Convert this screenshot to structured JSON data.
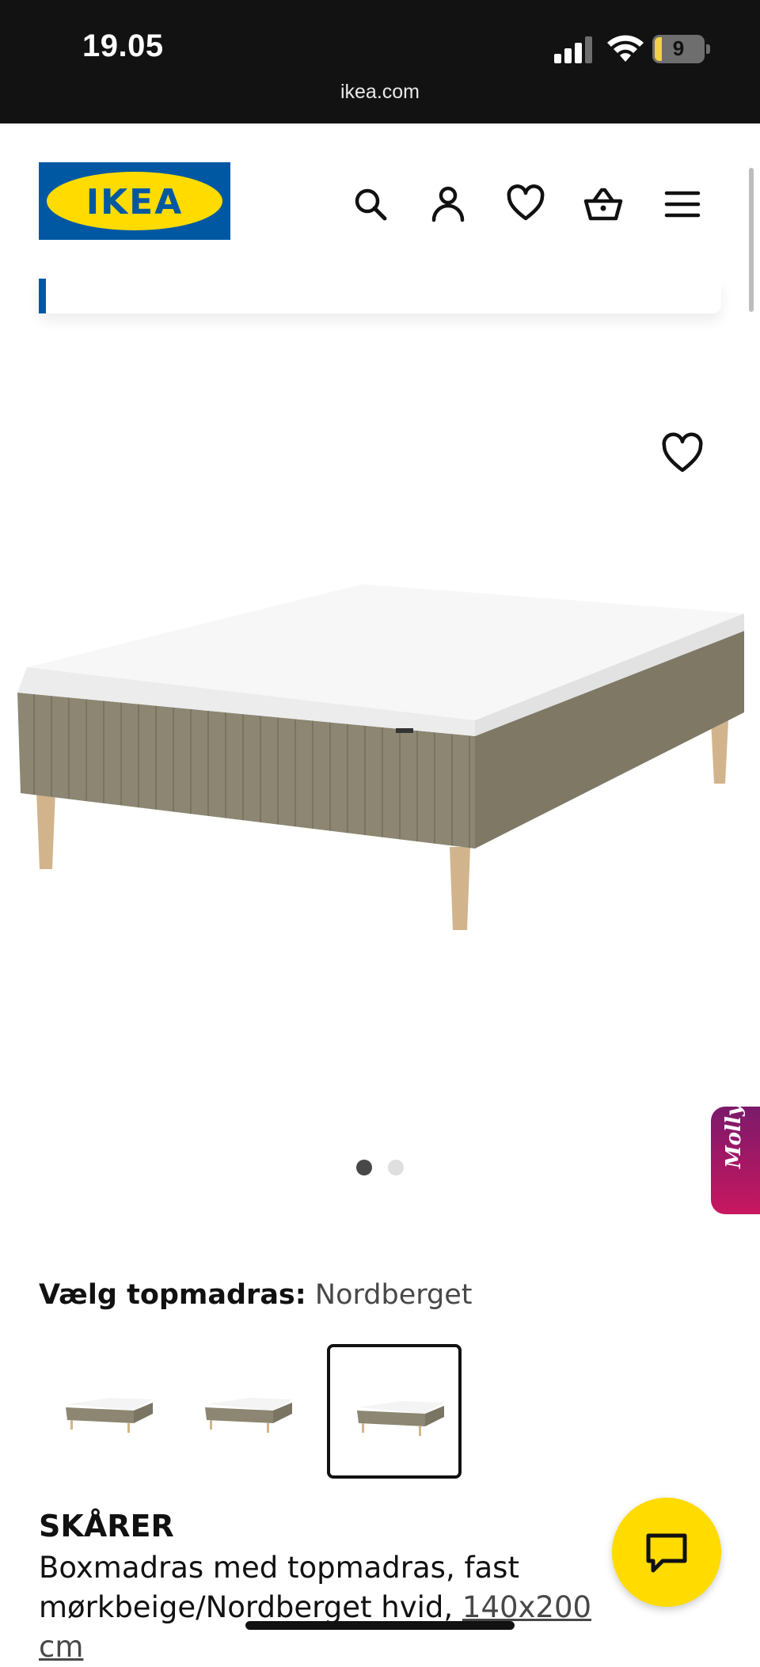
{
  "status_bar": {
    "time": "19.05",
    "battery_level": "9",
    "url": "ikea.com"
  },
  "header": {
    "logo_text": "IKEA",
    "icons": [
      "search-icon",
      "account-icon",
      "heart-icon",
      "basket-icon",
      "menu-icon"
    ]
  },
  "product": {
    "image_count": 2,
    "active_image_index": 0,
    "choose_label": "Vælg topmadras:",
    "choose_value": "Nordberget",
    "variants": [
      {
        "name": "variant-1",
        "selected": false
      },
      {
        "name": "variant-2",
        "selected": false
      },
      {
        "name": "variant-3",
        "selected": true
      }
    ],
    "name": "SKÅRER",
    "description_line1": "Boxmadras med topmadras, fast",
    "description_line2": "mørkbeige/Nordberget hvid,",
    "size": "140x200 cm"
  },
  "assistant": {
    "label": "Molly"
  },
  "colors": {
    "brand_blue": "#0058a3",
    "brand_yellow": "#ffdb00",
    "fabric_beige": "#8c8672",
    "molly_gradient_start": "#7b1a6b",
    "molly_gradient_end": "#c8175f"
  }
}
